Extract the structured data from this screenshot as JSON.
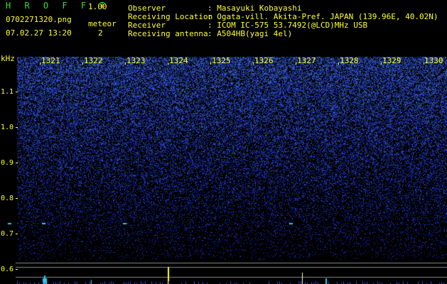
{
  "app": {
    "name": "H R O F F T",
    "version": "1.00",
    "filename": "0702271320.png",
    "datetime": "07.02.27 13:20",
    "meteor_label": "meteor",
    "meteor_count": "2"
  },
  "info": [
    {
      "label": "Observer",
      "value": ": Masayuki Kobayashi"
    },
    {
      "label": "Receiving Location",
      "value": ": Ogata-vill. Akita-Pref. JAPAN (139.96E, 40.02N)"
    },
    {
      "label": "Receiver",
      "value": ": ICOM IC-575 53.7492(@LCD)MHz USB"
    },
    {
      "label": "Receiving antenna",
      "value": ": A504HB(yagi 4el)"
    }
  ],
  "y_axis": {
    "unit": "kHz",
    "ticks": [
      "1.1",
      "1.0",
      "0.9",
      "0.8",
      "0.7",
      "0.6"
    ]
  },
  "x_axis": {
    "ticks": [
      "1321",
      "1322",
      "1323",
      "1324",
      "1325",
      "1326",
      "1327",
      "1328",
      "1329",
      "1330"
    ]
  },
  "colors": {
    "background": "#000000",
    "text_green": "#33dd33",
    "text_yellow": "#ffff33",
    "noise_blue": "#3344cc",
    "echo_cyan": "#22ccee"
  },
  "echoes": [
    {
      "minute": "1320.3",
      "freq_khz": "0.73"
    },
    {
      "minute": "1321.1",
      "freq_khz": "0.73"
    },
    {
      "minute": "1323.0",
      "freq_khz": "0.73"
    },
    {
      "minute": "1326.9",
      "freq_khz": "0.73"
    }
  ]
}
